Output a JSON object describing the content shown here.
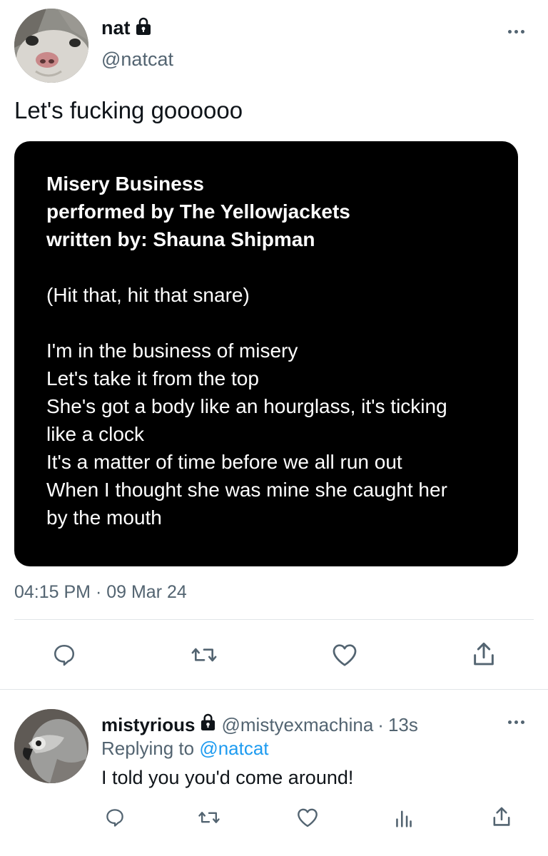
{
  "tweet": {
    "author": {
      "display_name": "nat",
      "handle": "@natcat",
      "protected": true,
      "avatar": "cat-closeup-avatar"
    },
    "text": "Let's fucking goooooo",
    "media": {
      "heading_lines": [
        "Misery Business",
        "performed by The Yellowjackets",
        "written by: Shauna Shipman"
      ],
      "intro_line": "(Hit that, hit that snare)",
      "lyric_lines": [
        "I'm in the business of misery",
        "Let's take it from the top",
        "She's got a body like an hourglass, it's ticking",
        "like a clock",
        "It's a matter of time before we all run out",
        "When I thought she was mine she caught her",
        "by the mouth"
      ]
    },
    "timestamp": "04:15 PM · 09 Mar 24",
    "actions": [
      "reply-icon",
      "retweet-icon",
      "like-icon",
      "share-icon"
    ]
  },
  "reply": {
    "author": {
      "display_name": "mistyrious",
      "handle": "@mistyexmachina",
      "protected": true,
      "avatar": "grey-parrot-avatar"
    },
    "time": "13s",
    "separator": "·",
    "replying_to_prefix": "Replying to",
    "replying_to_handle": "@natcat",
    "text": "I told you you'd come around!",
    "actions": [
      "reply-icon",
      "retweet-icon",
      "like-icon",
      "analytics-icon",
      "share-icon"
    ]
  },
  "colors": {
    "text_primary": "#0f1419",
    "text_secondary": "#536471",
    "link": "#1d9bf0",
    "divider": "#e1e5e8",
    "media_bg": "#000000"
  }
}
